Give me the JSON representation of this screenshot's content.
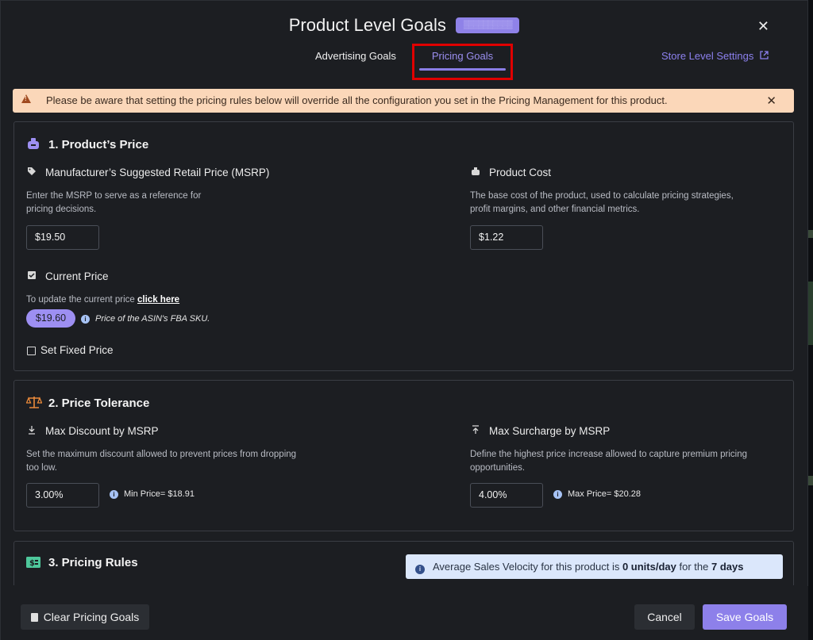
{
  "header": {
    "title": "Product Level Goals",
    "badge": "▒▒▒▒▒▒▒▒▒▒",
    "close_label": "✕"
  },
  "tabs": [
    {
      "label": "Advertising Goals",
      "active": false
    },
    {
      "label": "Pricing Goals",
      "active": true
    }
  ],
  "store_link": {
    "label": "Store Level Settings",
    "icon": "external-link-icon"
  },
  "alert": {
    "message": "Please be aware that setting the pricing rules below will override all the configuration you set in the Pricing Management for this product.",
    "close_label": "✕",
    "color": "#fbd7b9"
  },
  "section1": {
    "title": "1. Product’s Price",
    "msrp": {
      "label": "Manufacturer’s Suggested Retail Price (MSRP)",
      "help_line1": "Enter the MSRP to serve as a reference for",
      "help_line2": "pricing decisions.",
      "value": "$19.50"
    },
    "cost": {
      "label": "Product Cost",
      "help_line1": "The base cost of the product, used to calculate pricing strategies,",
      "help_line2": "profit margins, and other financial metrics.",
      "value": "$1.22"
    },
    "current_price": {
      "label": "Current Price",
      "update_text": "To update the current price",
      "update_link": "click here",
      "price": "$19.60",
      "note": "Price of the ASIN's FBA SKU."
    },
    "fixed_price_label": "Set Fixed Price"
  },
  "section2": {
    "title": "2. Price Tolerance",
    "discount": {
      "label": "Max Discount by MSRP",
      "help_line1": "Set the maximum discount allowed to prevent prices from dropping",
      "help_line2": "too low.",
      "value": "3.00%",
      "hint": "Min Price= $18.91"
    },
    "surcharge": {
      "label": "Max Surcharge by MSRP",
      "help_line1": "Define the highest price increase allowed to capture premium pricing",
      "help_line2": "opportunities.",
      "value": "4.00%",
      "hint": "Max Price= $20.28"
    }
  },
  "section3": {
    "title": "3. Pricing Rules",
    "velocity_prefix": "Average Sales Velocity for this product is",
    "velocity_value": "0 units/day",
    "velocity_mid": "for the",
    "velocity_days": "7 days"
  },
  "footer": {
    "clear_label": "Clear Pricing Goals",
    "cancel_label": "Cancel",
    "save_label": "Save Goals"
  },
  "colors": {
    "accent": "#8d80ea",
    "alert_bg": "#fbd7b9",
    "info_bg": "#dbe7fb",
    "tab_highlight": "#e00000"
  }
}
